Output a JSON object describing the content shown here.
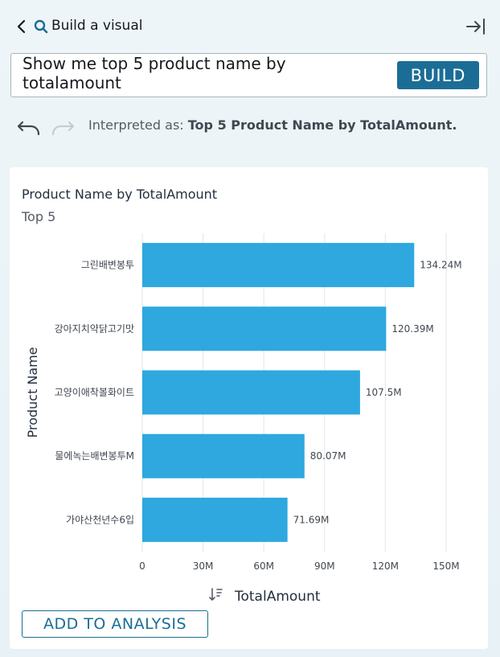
{
  "header": {
    "title": "Build a visual",
    "back_icon": "chevron-left-icon",
    "brand_icon": "q-search-icon",
    "collapse_icon": "arrow-right-to-bar-icon"
  },
  "query": {
    "value": "Show me top 5 product name by totalamount",
    "build_label": "BUILD"
  },
  "history": {
    "undo_icon": "undo-icon",
    "redo_icon": "redo-icon",
    "interpreted_prefix": "Interpreted as:",
    "interpreted_value": "Top 5 Product Name by TotalAmount."
  },
  "colors": {
    "bar": "#2ea8df",
    "accent": "#1b6d96"
  },
  "chart_data": {
    "type": "bar",
    "orientation": "horizontal",
    "title": "Product Name by TotalAmount",
    "subtitle": "Top 5",
    "xlabel": "TotalAmount",
    "ylabel": "Product Name",
    "categories": [
      "그린배변봉투",
      "강아지치약닭고기맛",
      "고양이애착볼화이트",
      "물에녹는배변봉투M",
      "가야산천년수6입"
    ],
    "values": [
      134.24,
      120.39,
      107.5,
      80.07,
      71.69
    ],
    "value_labels": [
      "134.24M",
      "120.39M",
      "107.5M",
      "80.07M",
      "71.69M"
    ],
    "xlim": [
      0,
      150
    ],
    "xticks": [
      0,
      30,
      60,
      90,
      120,
      150
    ],
    "xtick_labels": [
      "0",
      "30M",
      "60M",
      "90M",
      "120M",
      "150M"
    ],
    "grid": true,
    "sort_icon": "sort-descending-icon"
  },
  "actions": {
    "add_label": "ADD TO ANALYSIS"
  }
}
